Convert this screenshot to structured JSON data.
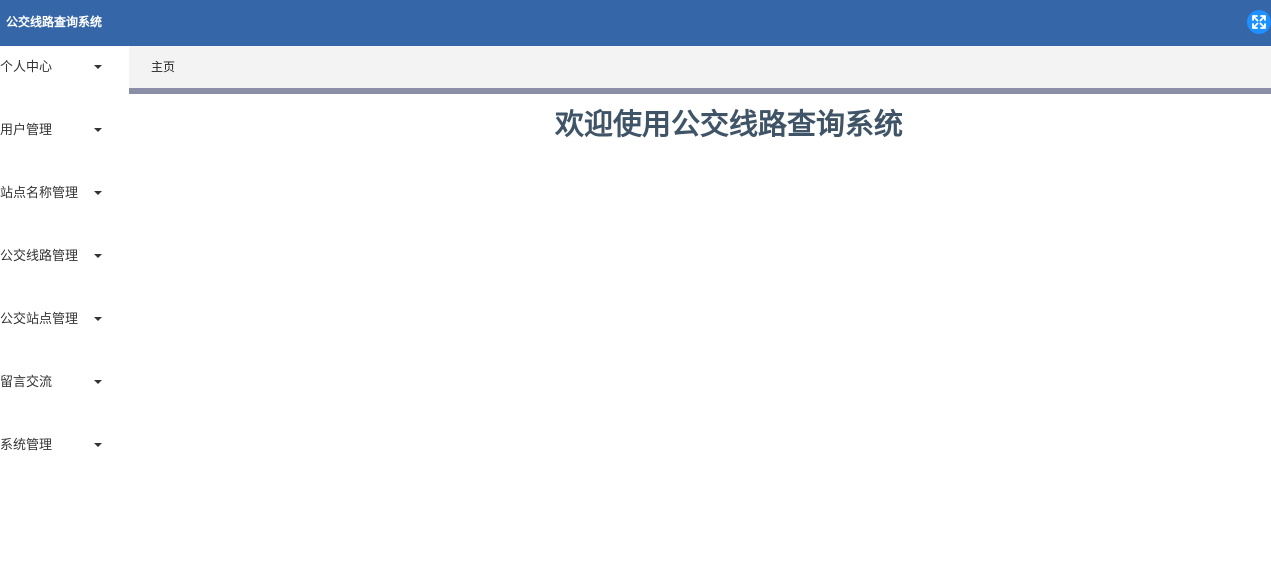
{
  "app": {
    "title": "公交线路查询系统"
  },
  "sidebar": {
    "items": [
      {
        "label": "个人中心"
      },
      {
        "label": "用户管理"
      },
      {
        "label": "站点名称管理"
      },
      {
        "label": "公交线路管理"
      },
      {
        "label": "公交站点管理"
      },
      {
        "label": "留言交流"
      },
      {
        "label": "系统管理"
      }
    ]
  },
  "tabs": {
    "home": "主页"
  },
  "main": {
    "welcome": "欢迎使用公交线路查询系统"
  },
  "icons": {
    "fullscreen": "fullscreen-icon",
    "caret": "caret-down-icon"
  },
  "colors": {
    "header_bg": "#3566a8",
    "fullscreen_btn": "#1e90ff",
    "tab_bar_bg": "#f3f3f3",
    "tab_underline": "#8c8ea8",
    "welcome_text": "#3f5466"
  }
}
